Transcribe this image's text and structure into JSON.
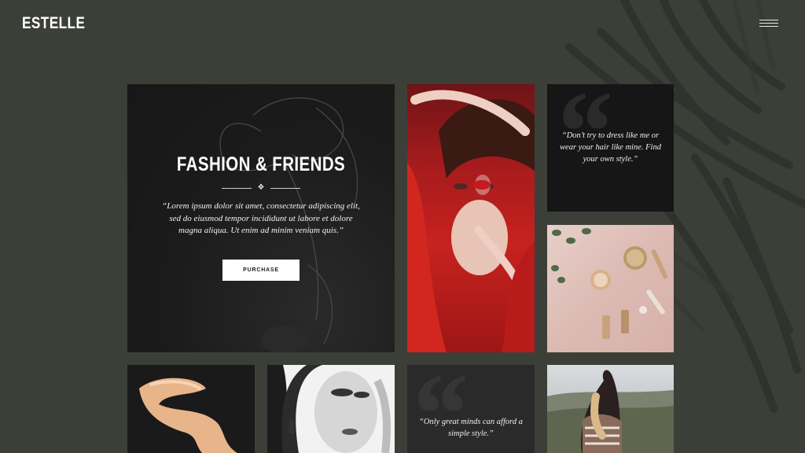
{
  "brand": {
    "logo": "ESTELLE"
  },
  "hero": {
    "title": "FASHION & FRIENDS",
    "text": "“Lorem ipsum dolor sit amet, consectetur adipiscing elit, sed do eiusmod tempor incididunt ut labore et dolore magna aliqua. Ut enim ad minim veniam quis.”",
    "button_label": "PURCHASE"
  },
  "quotes": [
    {
      "text": "“Don’t try to dress like me or wear your hair like mine. Find your own style.”"
    },
    {
      "text": "“Only great minds can afford a simple style.”"
    }
  ],
  "icons": {
    "menu": "hamburger-icon",
    "divider": "diamond-ornament-icon",
    "quote": "quote-mark-icon"
  },
  "colors": {
    "background": "#3c3f38",
    "tile_dark": "#1b1b1b",
    "accent_red": "#c7221f",
    "button_bg": "#ffffff"
  }
}
